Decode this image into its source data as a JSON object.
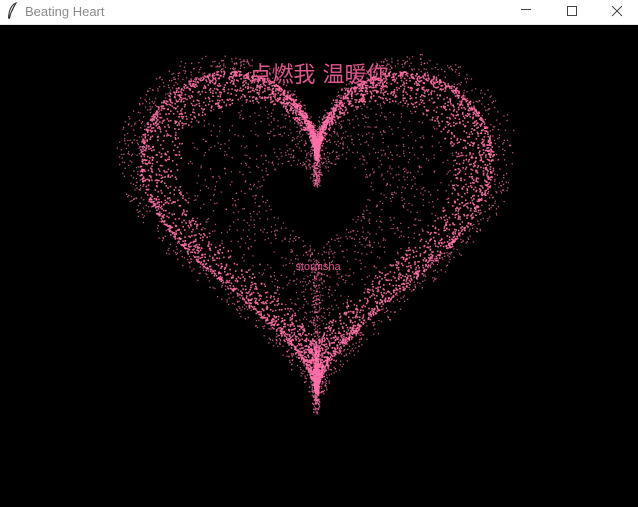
{
  "window": {
    "title": "Beating Heart",
    "icon": "feather-icon",
    "controls": [
      "minimize-icon",
      "maximize-icon",
      "close-icon"
    ]
  },
  "canvas": {
    "background": "#000000",
    "heading": "点燃我  温暖你",
    "center_label": "stormsha",
    "accent_color": "#ff6fa8",
    "text_color": "#e0558f"
  }
}
